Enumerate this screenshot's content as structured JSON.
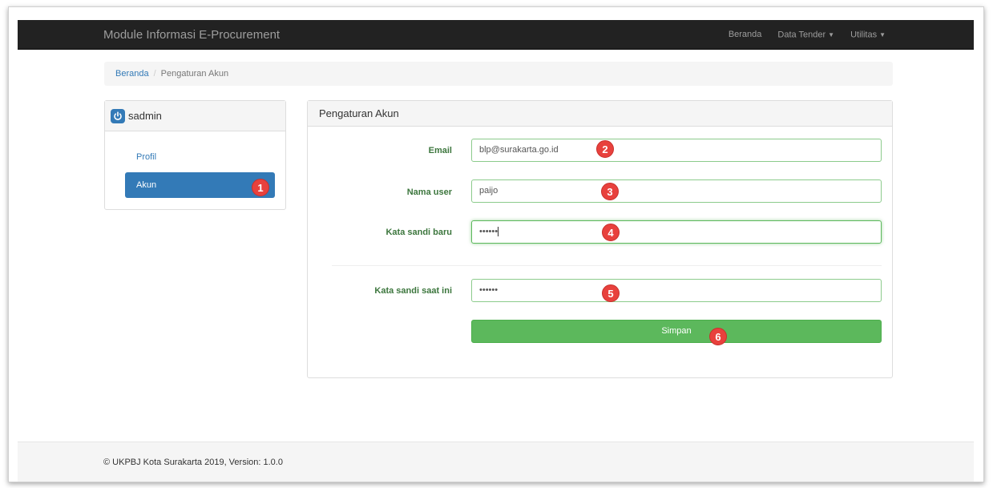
{
  "navbar": {
    "brand": "Module Informasi E-Procurement",
    "links": [
      {
        "label": "Beranda",
        "dropdown": false
      },
      {
        "label": "Data Tender",
        "dropdown": true
      },
      {
        "label": "Utilitas",
        "dropdown": true
      }
    ]
  },
  "breadcrumb": {
    "home": "Beranda",
    "separator": "/",
    "current": "Pengaturan Akun"
  },
  "sidebar": {
    "username": "sadmin",
    "items": [
      {
        "label": "Profil",
        "active": false
      },
      {
        "label": "Akun",
        "active": true
      }
    ]
  },
  "form": {
    "title": "Pengaturan Akun",
    "email_label": "Email",
    "email_value": "blp@surakarta.go.id",
    "username_label": "Nama user",
    "username_value": "paijo",
    "new_password_label": "Kata sandi baru",
    "new_password_value": "••••••",
    "current_password_label": "Kata sandi saat ini",
    "current_password_value": "••••••",
    "save_label": "Simpan"
  },
  "markers": [
    "1",
    "2",
    "3",
    "4",
    "5",
    "6"
  ],
  "footer": {
    "text": "© UKPBJ Kota Surakarta 2019, Version: 1.0.0"
  },
  "colors": {
    "navbar": "#222222",
    "primary": "#337ab7",
    "success": "#5cb85c",
    "label_green": "#3c763d",
    "marker": "#e8413d"
  }
}
